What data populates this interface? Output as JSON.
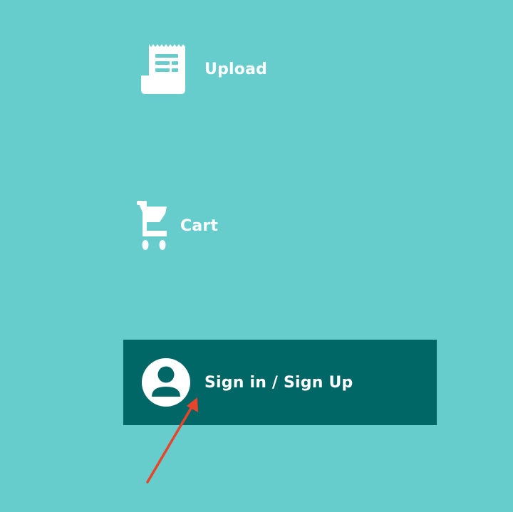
{
  "colors": {
    "background": "#66cccc",
    "highlight": "#006666",
    "foreground": "#ffffff",
    "arrow": "#e8442a"
  },
  "menu": {
    "upload": {
      "label": "Upload",
      "icon": "receipt-icon"
    },
    "cart": {
      "label": "Cart",
      "icon": "shopping-cart-icon"
    },
    "signin": {
      "label": "Sign in / Sign Up",
      "icon": "user-avatar-icon"
    }
  },
  "annotation": {
    "icon": "arrow-pointer-icon"
  }
}
